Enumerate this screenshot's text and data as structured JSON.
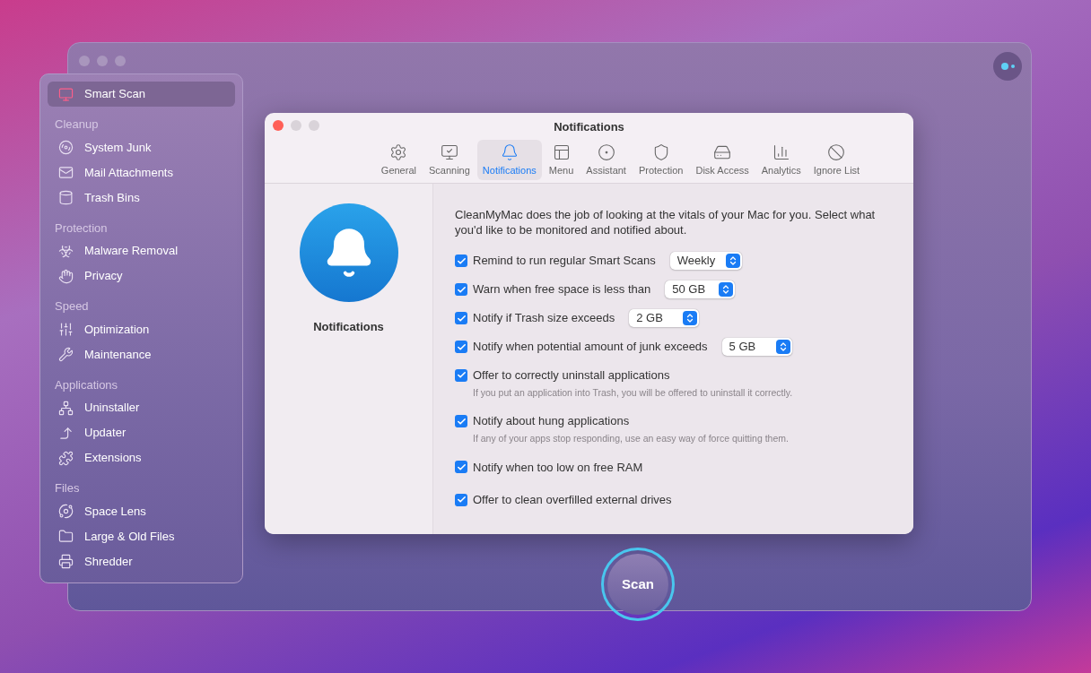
{
  "sidebar": {
    "top": {
      "label": "Smart Scan",
      "selected": true
    },
    "sections": [
      {
        "title": "Cleanup",
        "items": [
          {
            "label": "System Junk",
            "selected": false
          },
          {
            "label": "Mail Attachments",
            "selected": false
          },
          {
            "label": "Trash Bins",
            "selected": false
          }
        ]
      },
      {
        "title": "Protection",
        "items": [
          {
            "label": "Malware Removal",
            "selected": false
          },
          {
            "label": "Privacy",
            "selected": false
          }
        ]
      },
      {
        "title": "Speed",
        "items": [
          {
            "label": "Optimization",
            "selected": false
          },
          {
            "label": "Maintenance",
            "selected": false
          }
        ]
      },
      {
        "title": "Applications",
        "items": [
          {
            "label": "Uninstaller",
            "selected": false
          },
          {
            "label": "Updater",
            "selected": false
          },
          {
            "label": "Extensions",
            "selected": false
          }
        ]
      },
      {
        "title": "Files",
        "items": [
          {
            "label": "Space Lens",
            "selected": false
          },
          {
            "label": "Large & Old Files",
            "selected": false
          },
          {
            "label": "Shredder",
            "selected": false
          }
        ]
      }
    ]
  },
  "dialog": {
    "title": "Notifications",
    "tabs": [
      {
        "label": "General",
        "selected": false
      },
      {
        "label": "Scanning",
        "selected": false
      },
      {
        "label": "Notifications",
        "selected": true
      },
      {
        "label": "Menu",
        "selected": false
      },
      {
        "label": "Assistant",
        "selected": false
      },
      {
        "label": "Protection",
        "selected": false
      },
      {
        "label": "Disk Access",
        "selected": false
      },
      {
        "label": "Analytics",
        "selected": false
      },
      {
        "label": "Ignore List",
        "selected": false
      }
    ],
    "pane_label": "Notifications",
    "description": "CleanMyMac does the job of looking at the vitals of your Mac for you. Select what you'd like to be monitored and notified about.",
    "options": [
      {
        "kind": "select",
        "checked": true,
        "label": "Remind to run regular Smart Scans",
        "value": "Weekly"
      },
      {
        "kind": "select",
        "checked": true,
        "label": "Warn when free space is less than",
        "value": "50 GB"
      },
      {
        "kind": "select",
        "checked": true,
        "label": "Notify if Trash size exceeds",
        "value": "2 GB"
      },
      {
        "kind": "select",
        "checked": true,
        "label": "Notify when potential amount of junk exceeds",
        "value": "5 GB"
      },
      {
        "kind": "note",
        "checked": true,
        "label": "Offer to correctly uninstall applications",
        "note": "If you put an application into Trash, you will be offered to uninstall it correctly."
      },
      {
        "kind": "note",
        "checked": true,
        "label": "Notify about hung applications",
        "note": "If any of your apps stop responding, use an easy way of force quitting them."
      },
      {
        "kind": "plain",
        "checked": true,
        "label": "Notify when too low on free RAM"
      },
      {
        "kind": "plain",
        "checked": true,
        "label": "Offer to clean overfilled external drives"
      }
    ]
  },
  "scan_button": "Scan"
}
